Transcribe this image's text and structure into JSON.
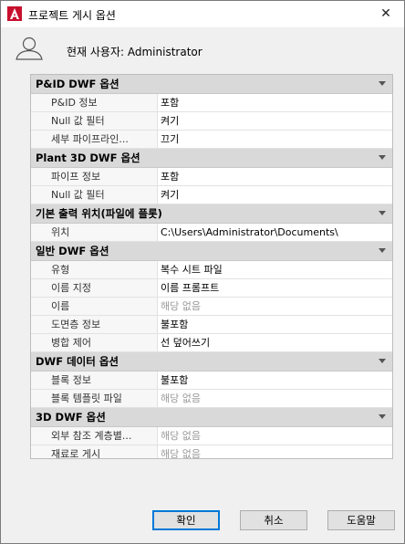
{
  "window": {
    "title": "프로젝트 게시 옵션",
    "close_glyph": "✕",
    "accent_color": "#c8102e"
  },
  "user": {
    "label": "현재 사용자: Administrator"
  },
  "sections": [
    {
      "title": "P&ID DWF 옵션",
      "rows": [
        {
          "label": "P&ID 정보",
          "value": "포함",
          "dim": false
        },
        {
          "label": "Null 값 필터",
          "value": "켜기",
          "dim": false
        },
        {
          "label": "세부 파이프라인...",
          "value": "끄기",
          "dim": false
        }
      ]
    },
    {
      "title": "Plant 3D DWF 옵션",
      "rows": [
        {
          "label": "파이프 정보",
          "value": "포함",
          "dim": false
        },
        {
          "label": "Null 값 필터",
          "value": "켜기",
          "dim": false
        }
      ]
    },
    {
      "title": "기본 출력 위치(파일에 플롯)",
      "rows": [
        {
          "label": "위치",
          "value": "C:\\Users\\Administrator\\Documents\\",
          "dim": false
        }
      ]
    },
    {
      "title": "일반 DWF 옵션",
      "rows": [
        {
          "label": "유형",
          "value": "복수 시트 파일",
          "dim": false
        },
        {
          "label": "이름 지정",
          "value": "이름 프롬프트",
          "dim": false
        },
        {
          "label": "이름",
          "value": "해당 없음",
          "dim": true
        },
        {
          "label": "도면층 정보",
          "value": "불포함",
          "dim": false
        },
        {
          "label": "병합 제어",
          "value": "선 덮어쓰기",
          "dim": false
        }
      ]
    },
    {
      "title": "DWF 데이터 옵션",
      "rows": [
        {
          "label": "블록 정보",
          "value": "불포함",
          "dim": false
        },
        {
          "label": "블록 템플릿 파일",
          "value": "해당 없음",
          "dim": true
        }
      ]
    },
    {
      "title": "3D DWF 옵션",
      "rows": [
        {
          "label": "외부 참조 계층별...",
          "value": "해당 없음",
          "dim": true
        },
        {
          "label": "재료로 게시",
          "value": "해당 없음",
          "dim": true
        }
      ]
    }
  ],
  "buttons": {
    "ok": "확인",
    "cancel": "취소",
    "help": "도움말"
  }
}
